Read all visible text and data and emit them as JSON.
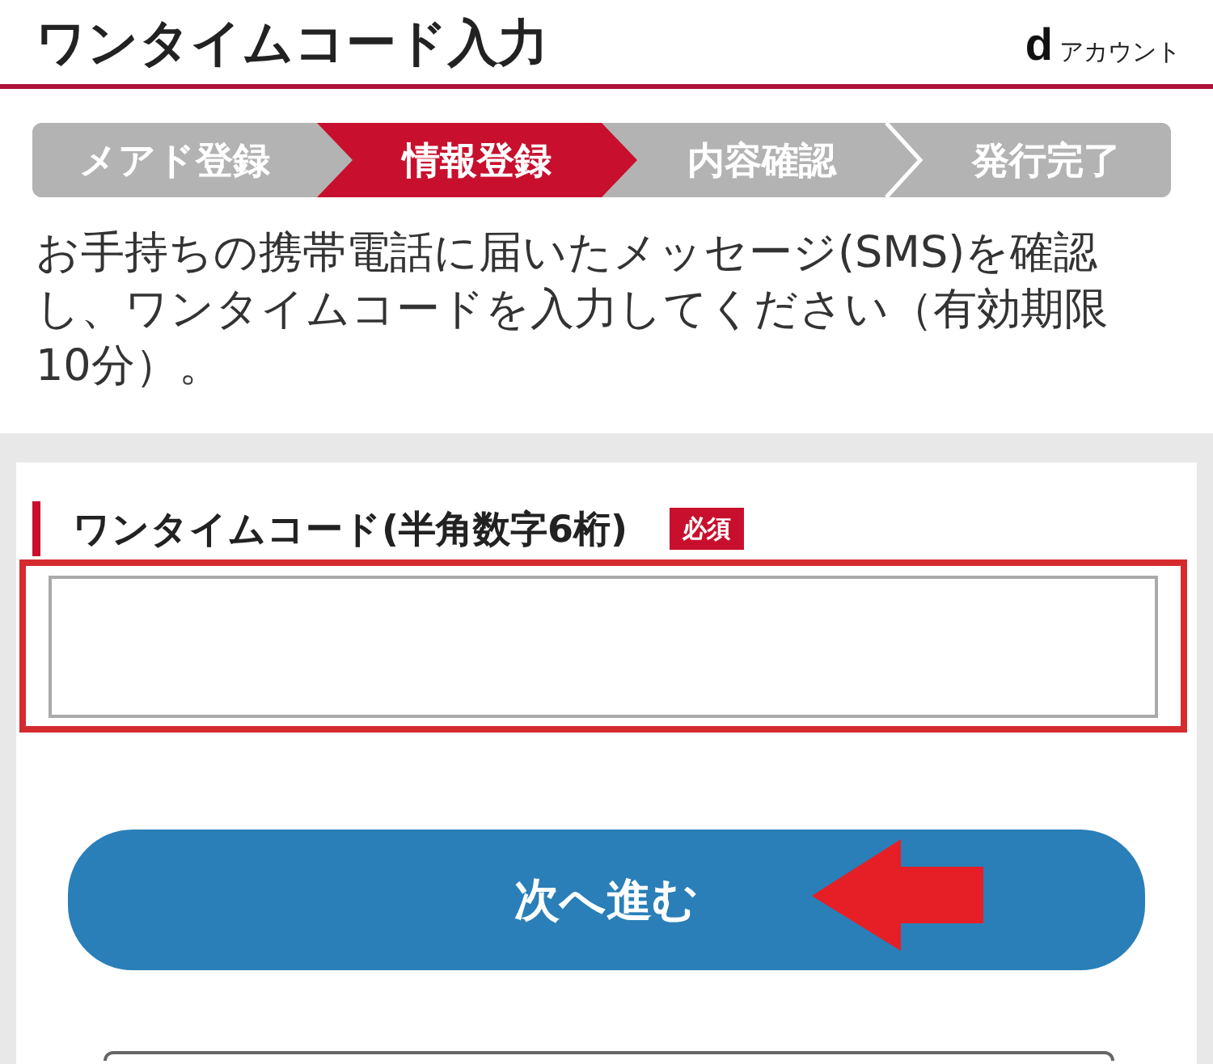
{
  "header": {
    "title": "ワンタイムコード入力",
    "brand": {
      "logo": "d",
      "name": "アカウント"
    }
  },
  "steps": [
    {
      "label": "メアド登録",
      "selected": false
    },
    {
      "label": "情報登録",
      "selected": true
    },
    {
      "label": "内容確認",
      "selected": false
    },
    {
      "label": "発行完了",
      "selected": false
    }
  ],
  "instructions": "お手持ちの携帯電話に届いたメッセージ(SMS)を確認し、ワンタイムコードを入力してください（有効期限10分）。",
  "form": {
    "label": "ワンタイムコード(半角数字6桁)",
    "required_badge": "必須",
    "code_field": {
      "highlighted": true
    },
    "next_button": {
      "label": "次へ進む",
      "pointer_arrow": true
    }
  }
}
